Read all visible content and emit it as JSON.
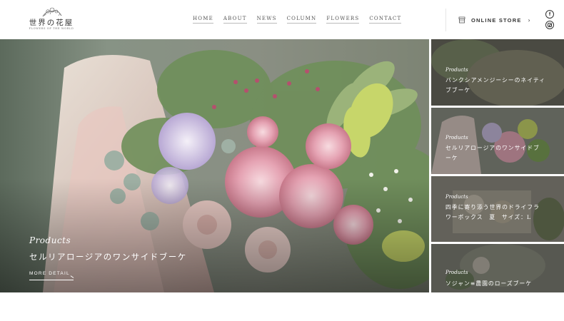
{
  "brand": {
    "name": "世界の花屋",
    "tagline": "FLOWERS OF THE WORLD"
  },
  "nav": {
    "items": [
      {
        "label": "HOME"
      },
      {
        "label": "ABOUT"
      },
      {
        "label": "NEWS"
      },
      {
        "label": "COLUMN"
      },
      {
        "label": "FLOWERS"
      },
      {
        "label": "CONTACT"
      }
    ]
  },
  "store": {
    "label": "ONLINE STORE",
    "icon": "store-icon"
  },
  "social": {
    "facebook_glyph": "f",
    "icons": [
      "facebook-icon",
      "instagram-icon"
    ]
  },
  "hero": {
    "eyebrow": "Products",
    "title": "セルリアロージアのワンサイドブーケ",
    "more_label": "MORE DETAIL"
  },
  "cards": [
    {
      "eyebrow": "Products",
      "title": "バンクシアメンジーシーのネイティブブーケ"
    },
    {
      "eyebrow": "Products",
      "title": "セルリアロージアのワンサイドブーケ"
    },
    {
      "eyebrow": "Products",
      "title": "四季に寄り添う世界のドライフラワーボックス　夏　サイズ：L"
    },
    {
      "eyebrow": "Products",
      "title": "ソジャン≡農園のローズブーケ"
    }
  ],
  "colors": {
    "text": "#333333",
    "overlay": "#000000",
    "protea_pink": "#e9a9b8",
    "leaf_green": "#7fa35a",
    "leucadendron_lime": "#c7d66a",
    "scabiosa_lavender": "#c9bde0"
  }
}
